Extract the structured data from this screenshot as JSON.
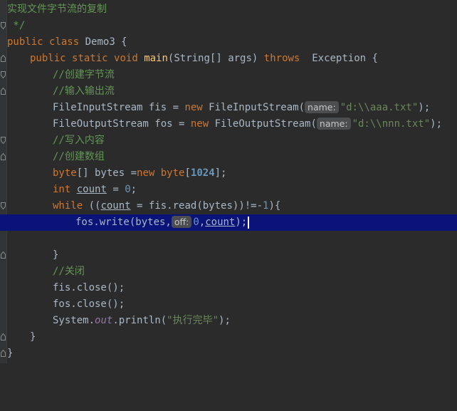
{
  "editor": {
    "lines": {
      "l0": "实现文件字节流的复制",
      "l1": " */",
      "l2_kw1": "public",
      "l2_kw2": "class",
      "l2_rest": " Demo3 {",
      "l3_kw1": "public",
      "l3_kw2": "static",
      "l3_kw3": "void",
      "l3_fn": "main",
      "l3_rest": "(String[] args)",
      "l3_throws": "throws",
      "l3_exc": "  Exception {",
      "l4": "//创建字节流",
      "l5": "//输入输出流",
      "l6_a": "FileInputStream fis = ",
      "l6_new": "new",
      "l6_b": " FileInputStream(",
      "l6_hint": "name:",
      "l6_str": "\"d:\\\\aaa.txt\"",
      "l6_c": ");",
      "l7_a": "FileOutputStream fos = ",
      "l7_new": "new",
      "l7_b": " FileOutputStream(",
      "l7_hint": "name:",
      "l7_str": "\"d:\\\\nnn.txt\"",
      "l7_c": ");",
      "l8": "//写入内容",
      "l9": "//创建数组",
      "l10_kw": "byte",
      "l10_a": "[] bytes =",
      "l10_new": "new",
      "l10_kw2": " byte",
      "l10_b": "[",
      "l10_num": "1024",
      "l10_c": "];",
      "l11_kw": "int",
      "l11_var": "count",
      "l11_a": " = ",
      "l11_num": "0",
      "l11_b": ";",
      "l12_kw": "while",
      "l12_a": " ((",
      "l12_var": "count",
      "l12_b": " = fis.read(bytes))!=-",
      "l12_num": "1",
      "l12_c": "){",
      "l13_a": "fos.write(bytes,",
      "l13_hint": "off:",
      "l13_num": "0",
      "l13_b": ",",
      "l13_var": "count",
      "l13_c": ");",
      "l15": "}",
      "l16": "//关闭",
      "l17": "fis.close();",
      "l18": "fos.close();",
      "l19_a": "System.",
      "l19_field": "out",
      "l19_b": ".println(",
      "l19_str": "\"执行完毕\"",
      "l19_c": ");",
      "l20": "}",
      "l21": "}"
    }
  }
}
